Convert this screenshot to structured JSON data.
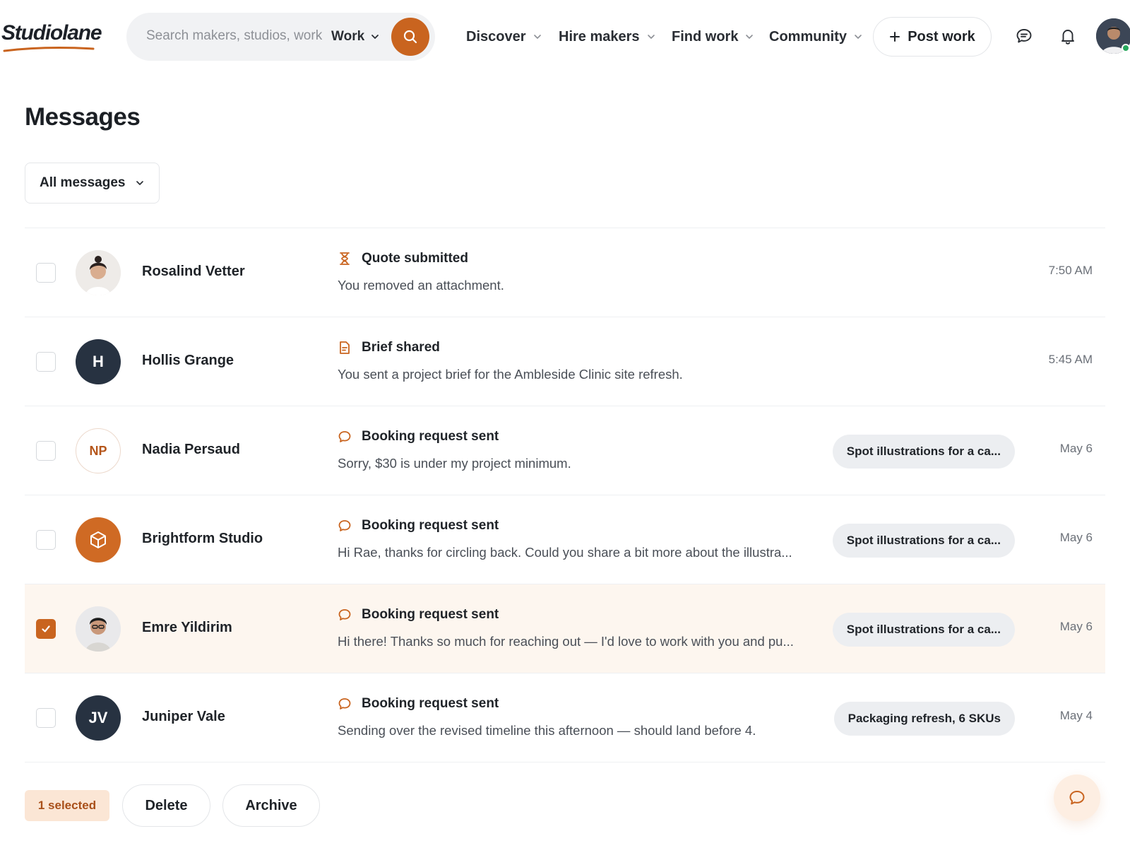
{
  "header": {
    "logo": "Studiolane",
    "search": {
      "placeholder": "Search makers, studios, work",
      "scope": "Work"
    },
    "nav": [
      {
        "label": "Discover"
      },
      {
        "label": "Hire makers"
      },
      {
        "label": "Find work"
      },
      {
        "label": "Community"
      }
    ],
    "post_button": "Post work",
    "icons": [
      "chat-icon",
      "bell-icon"
    ]
  },
  "page": {
    "title": "Messages",
    "filter": "All messages"
  },
  "messages": [
    {
      "name": "Rosalind Vetter",
      "avatar": {
        "type": "photo"
      },
      "subject_icon": "hourglass-icon",
      "subject": "Quote submitted",
      "preview": "You removed an attachment.",
      "tag": "",
      "time": "7:50 AM",
      "checked": false
    },
    {
      "name": "Hollis Grange",
      "avatar": {
        "type": "initials",
        "initials": "H"
      },
      "subject_icon": "document-icon",
      "subject": "Brief shared",
      "preview": "You sent a project brief for the Ambleside Clinic site refresh.",
      "tag": "",
      "time": "5:45 AM",
      "checked": false
    },
    {
      "name": "Nadia Persaud",
      "avatar": {
        "type": "initials-outline",
        "initials": "NP"
      },
      "subject_icon": "chat-bubble-icon",
      "subject": "Booking request sent",
      "preview": "Sorry, $30 is under my project minimum.",
      "tag": "Spot illustrations for a ca...",
      "time": "May 6",
      "checked": false
    },
    {
      "name": "Brightform Studio",
      "avatar": {
        "type": "logo"
      },
      "subject_icon": "chat-bubble-icon",
      "subject": "Booking request sent",
      "preview": "Hi Rae, thanks for circling back. Could you share a bit more about the illustra...",
      "tag": "Spot illustrations for a ca...",
      "time": "May 6",
      "checked": false
    },
    {
      "name": "Emre Yildirim",
      "avatar": {
        "type": "photo"
      },
      "subject_icon": "chat-bubble-icon",
      "subject": "Booking request sent",
      "preview": "Hi there! Thanks so much for reaching out — I'd love to work with you and pu...",
      "tag": "Spot illustrations for a ca...",
      "time": "May 6",
      "checked": true
    },
    {
      "name": "Juniper Vale",
      "avatar": {
        "type": "initials",
        "initials": "JV"
      },
      "subject_icon": "chat-bubble-icon",
      "subject": "Booking request sent",
      "preview": "Sending over the revised timeline this afternoon — should land before 4.",
      "tag": "Packaging refresh, 6 SKUs",
      "time": "May 4",
      "checked": false
    }
  ],
  "actions": {
    "selected_count": "1 selected",
    "delete": "Delete",
    "archive": "Archive"
  },
  "colors": {
    "accent": "#c9641f",
    "selected_row": "#fdf6ef",
    "badge_bg": "#fbe6d5"
  }
}
